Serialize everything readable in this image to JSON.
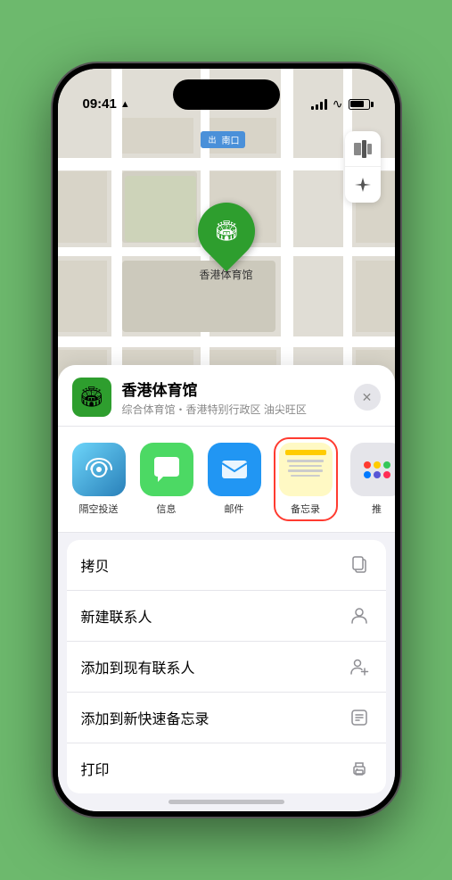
{
  "status_bar": {
    "time": "09:41",
    "location_arrow": "▶"
  },
  "map": {
    "label_text": "南口",
    "label_prefix": "出",
    "pin_emoji": "🏟",
    "pin_label": "香港体育馆",
    "control_map": "🗺",
    "control_location": "➤"
  },
  "sheet": {
    "venue_icon": "🏟",
    "venue_name": "香港体育馆",
    "venue_desc": "综合体育馆・香港特别行政区 油尖旺区",
    "close_label": "✕"
  },
  "share_items": [
    {
      "id": "airdrop",
      "label": "隔空投送",
      "type": "airdrop"
    },
    {
      "id": "messages",
      "label": "信息",
      "type": "messages"
    },
    {
      "id": "mail",
      "label": "邮件",
      "type": "mail"
    },
    {
      "id": "notes",
      "label": "备忘录",
      "type": "notes"
    },
    {
      "id": "more",
      "label": "推",
      "type": "more"
    }
  ],
  "actions": [
    {
      "id": "copy",
      "label": "拷贝",
      "icon": "copy"
    },
    {
      "id": "new-contact",
      "label": "新建联系人",
      "icon": "person"
    },
    {
      "id": "add-contact",
      "label": "添加到现有联系人",
      "icon": "person-add"
    },
    {
      "id": "quick-note",
      "label": "添加到新快速备忘录",
      "icon": "note"
    },
    {
      "id": "print",
      "label": "打印",
      "icon": "print"
    }
  ]
}
